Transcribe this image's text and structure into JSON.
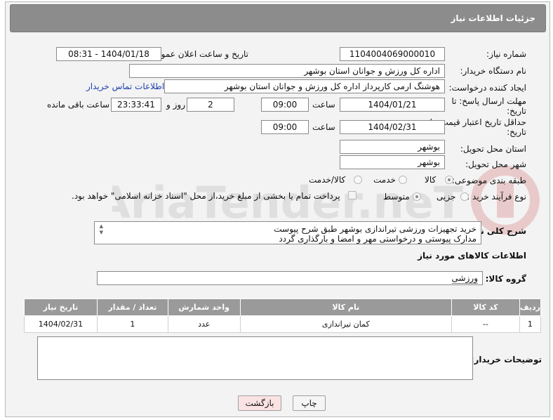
{
  "header": {
    "title": "جزئیات اطلاعات نیاز"
  },
  "fields": {
    "need_number_label": "شماره نیاز:",
    "need_number": "1104004069000010",
    "announce_label": "تاریخ و ساعت اعلان عمومی:",
    "announce_value": "1404/01/18 - 08:31",
    "buyer_org_label": "نام دستگاه خریدار:",
    "buyer_org": "اداره کل ورزش و جوانان استان بوشهر",
    "requester_label": "ایجاد کننده درخواست:",
    "requester": "هوشنگ ارمی کارپرداز اداره کل ورزش و جوانان استان بوشهر",
    "contact_link": "اطلاعات تماس خریدار",
    "reply_deadline_label": "مهلت ارسال پاسخ: تا تاریخ:",
    "reply_date": "1404/01/21",
    "time_label": "ساعت",
    "reply_time": "09:00",
    "days_value": "2",
    "days_label": "روز و",
    "remaining_time": "23:33:41",
    "remaining_label": "ساعت باقی مانده",
    "price_validity_label": "حداقل تاریخ اعتبار قیمت: تا تاریخ:",
    "validity_date": "1404/02/31",
    "validity_time": "09:00",
    "province_label": "استان محل تحویل:",
    "province": "بوشهر",
    "city_label": "شهر محل تحویل:",
    "city": "بوشهر",
    "category_label": "طبقه بندی موضوعی:",
    "category_options": [
      "کالا",
      "خدمت",
      "کالا/خدمت"
    ],
    "process_label": "نوع فرآیند خرید :",
    "process_options": [
      "جزیی",
      "متوسط"
    ],
    "payment_note": "پرداخت تمام یا بخشی از مبلغ خرید،از محل \"اسناد خزانه اسلامی\" خواهد بود.",
    "description_label": "شرح کلی نیاز:",
    "description_line1": "خرید تجهیزات ورزشی تیراندازی بوشهر طبق شرح پیوست",
    "description_line2": "مدارک پیوستی و درخواستی مهر و امضا و بارگذاری گردد"
  },
  "goods": {
    "section_title": "اطلاعات کالاهای مورد نیاز",
    "group_label": "گروه کالا:",
    "group_value": "ورزشی",
    "columns": [
      "ردیف",
      "کد کالا",
      "نام کالا",
      "واحد شمارش",
      "تعداد / مقدار",
      "تاریخ نیاز"
    ],
    "rows": [
      {
        "index": "1",
        "code": "--",
        "name": "کمان تیراندازی",
        "unit": "عدد",
        "qty": "1",
        "date": "1404/02/31"
      }
    ]
  },
  "buyer_notes_label": "توضیحات خریدار:",
  "buttons": {
    "print": "چاپ",
    "back": "بازگشت"
  },
  "watermark": "AriaTender.neT"
}
